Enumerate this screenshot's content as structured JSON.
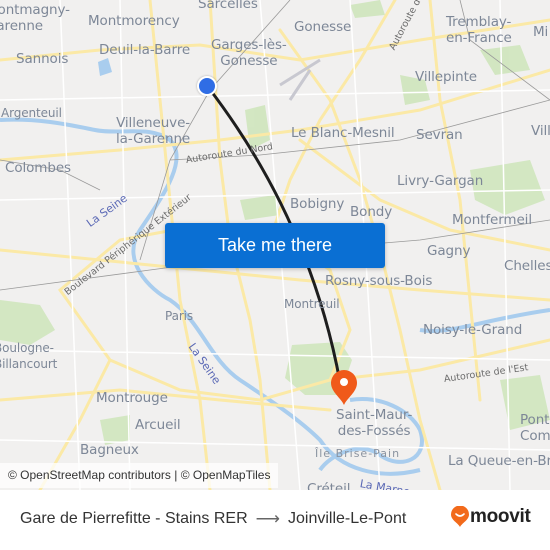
{
  "map": {
    "places": [
      {
        "id": "montmagny",
        "label": "Montmagny-\nGarenne",
        "partial": true
      },
      {
        "id": "sarcelles",
        "label": "Sarcelles"
      },
      {
        "id": "montmorency",
        "label": "Montmorency"
      },
      {
        "id": "gonesse",
        "label": "Gonesse"
      },
      {
        "id": "tremblay",
        "label": "Tremblay-\nen-France"
      },
      {
        "id": "mitry",
        "label": "Mi"
      },
      {
        "id": "deuil",
        "label": "Deuil-la-Barre"
      },
      {
        "id": "garges",
        "label": "Garges-lès-\nGonesse"
      },
      {
        "id": "sannois",
        "label": "Sannois"
      },
      {
        "id": "villepinte",
        "label": "Villepinte"
      },
      {
        "id": "argenteuil",
        "label": "Argenteuil"
      },
      {
        "id": "villeneuve",
        "label": "Villeneuve-\nla-Garenne"
      },
      {
        "id": "blancmesnil",
        "label": "Le Blanc-Mesnil"
      },
      {
        "id": "sevran",
        "label": "Sevran"
      },
      {
        "id": "vill",
        "label": "Vill"
      },
      {
        "id": "colombes",
        "label": "Colombes"
      },
      {
        "id": "livry",
        "label": "Livry-Gargan"
      },
      {
        "id": "bobigny",
        "label": "Bobigny"
      },
      {
        "id": "bondy",
        "label": "Bondy"
      },
      {
        "id": "montfermeil",
        "label": "Montfermeil"
      },
      {
        "id": "gagny",
        "label": "Gagny"
      },
      {
        "id": "chelles",
        "label": "Chelles"
      },
      {
        "id": "rosny",
        "label": "Rosny-sous-Bois"
      },
      {
        "id": "montreuil",
        "label": "Montreuil"
      },
      {
        "id": "paris",
        "label": "Paris"
      },
      {
        "id": "noisy",
        "label": "Noisy-le-Grand"
      },
      {
        "id": "boulogne",
        "label": "Boulogne-\nBillancourt"
      },
      {
        "id": "montrouge",
        "label": "Montrouge"
      },
      {
        "id": "saintmaur",
        "label": "Saint-Maur-\ndes-Fossés"
      },
      {
        "id": "pontault",
        "label": "Pont\nCom"
      },
      {
        "id": "arcueil",
        "label": "Arcueil"
      },
      {
        "id": "bagneux",
        "label": "Bagneux"
      },
      {
        "id": "ilebrise",
        "label": "Île Brise-Pain"
      },
      {
        "id": "queue",
        "label": "La Queue-en-Bri"
      },
      {
        "id": "creteil",
        "label": "Créteil"
      }
    ],
    "roads": {
      "autoroute_du_nord_1": "Autoroute du Nord",
      "autoroute_du_nord_2": "Autoroute du",
      "peripherique": "Boulevard Périphérique Extérieur",
      "autoroute_est": "Autoroute de l'Est"
    },
    "water": {
      "seine_1": "La Seine",
      "seine_2": "La Seine",
      "marne": "La Marne"
    },
    "attribution": "© OpenStreetMap contributors | © OpenMapTiles",
    "cta_label": "Take me there",
    "colors": {
      "origin": "#2f6de5",
      "destination": "#f05a1a",
      "route": "#1e1e1e",
      "cta": "#0a6fd3"
    }
  },
  "footer": {
    "origin": "Gare de Pierrefitte - Stains RER",
    "arrow": "⟶",
    "destination": "Joinville-Le-Pont",
    "brand": "moovit",
    "brand_color": "#f26a1b"
  }
}
